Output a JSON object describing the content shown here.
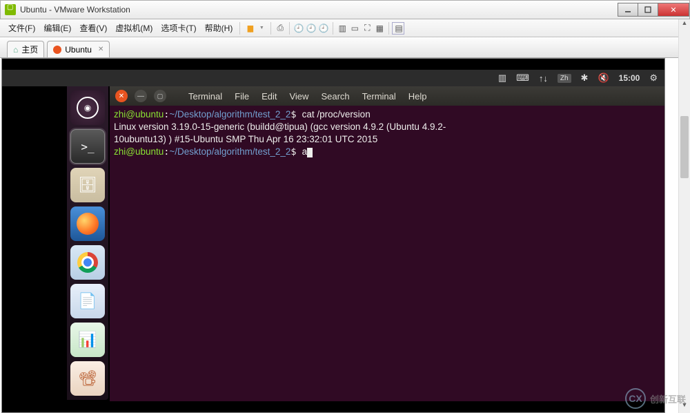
{
  "window": {
    "title": "Ubuntu - VMware Workstation"
  },
  "menubar": {
    "file": "文件(F)",
    "edit": "编辑(E)",
    "view": "查看(V)",
    "vm": "虚拟机(M)",
    "tabs": "选项卡(T)",
    "help": "帮助(H)"
  },
  "tabs": {
    "home": "主页",
    "ubuntu": "Ubuntu"
  },
  "ubuntu_panel": {
    "lang": "Zh",
    "time": "15:00"
  },
  "terminal": {
    "menu": {
      "terminal": "Terminal",
      "file": "File",
      "edit": "Edit",
      "view": "View",
      "search": "Search",
      "terminal2": "Terminal",
      "help": "Help"
    },
    "line1_prompt_user": "zhi@ubuntu",
    "line1_prompt_path": "~/Desktop/algorithm/test_2_2",
    "line1_cmd": "cat /proc/version",
    "output_l1": "Linux version 3.19.0-15-generic (buildd@tipua) (gcc version 4.9.2 (Ubuntu 4.9.2-",
    "output_l2": "10ubuntu13) ) #15-Ubuntu SMP Thu Apr 16 23:32:01 UTC 2015",
    "line2_prompt_user": "zhi@ubuntu",
    "line2_prompt_path": "~/Desktop/algorithm/test_2_2",
    "line2_cmd": "a"
  },
  "watermark": {
    "text": "创新互联"
  }
}
